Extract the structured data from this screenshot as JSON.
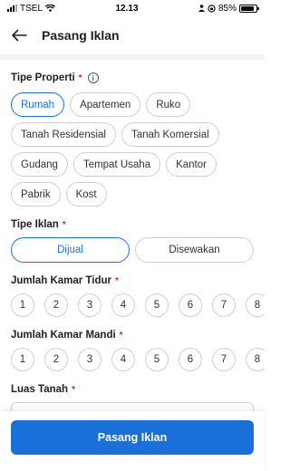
{
  "status_bar": {
    "carrier": "TSEL",
    "time": "12.13",
    "battery": "85%"
  },
  "header": {
    "title": "Pasang Iklan"
  },
  "tipe_properti": {
    "label": "Tipe Properti",
    "required_mark": "*",
    "options": [
      "Rumah",
      "Apartemen",
      "Ruko",
      "Tanah Residensial",
      "Tanah Komersial",
      "Gudang",
      "Tempat Usaha",
      "Kantor",
      "Pabrik",
      "Kost"
    ],
    "selected": "Rumah"
  },
  "tipe_iklan": {
    "label": "Tipe Iklan",
    "required_mark": "*",
    "options": [
      "Dijual",
      "Disewakan"
    ],
    "selected": "Dijual"
  },
  "kamar_tidur": {
    "label": "Jumlah Kamar Tidur",
    "required_mark": "*",
    "options": [
      "1",
      "2",
      "3",
      "4",
      "5",
      "6",
      "7",
      "8"
    ]
  },
  "kamar_mandi": {
    "label": "Jumlah Kamar Mandi",
    "required_mark": "*",
    "options": [
      "1",
      "2",
      "3",
      "4",
      "5",
      "6",
      "7",
      "8"
    ]
  },
  "luas_tanah": {
    "label": "Luas Tanah",
    "required_mark": "*"
  },
  "submit": {
    "label": "Pasang Iklan"
  },
  "colors": {
    "accent": "#1a6fd8",
    "required": "#e02424"
  },
  "icons": {
    "back": "arrow-left-icon",
    "info": "info-icon",
    "wifi": "wifi-icon",
    "battery": "battery-icon"
  }
}
